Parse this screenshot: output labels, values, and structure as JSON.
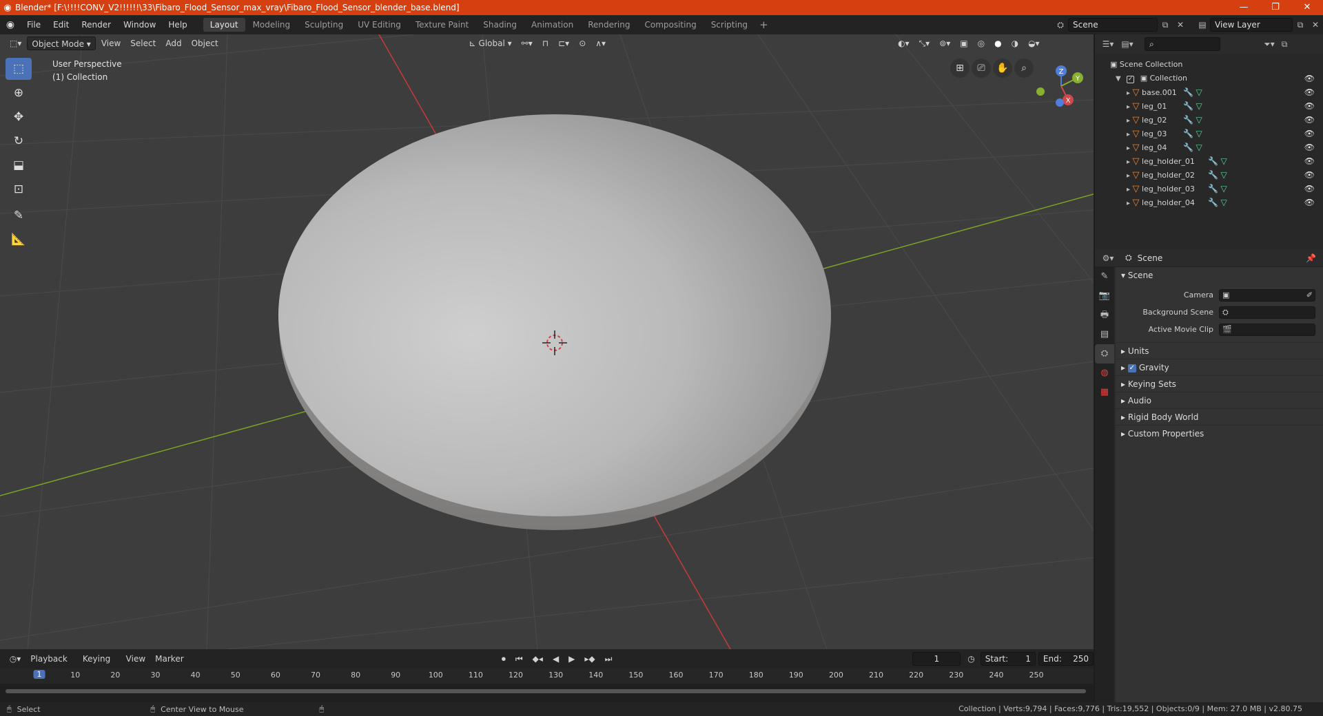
{
  "window": {
    "title": "Blender* [F:\\!!!!CONV_V2!!!!!!\\33\\Fibaro_Flood_Sensor_max_vray\\Fibaro_Flood_Sensor_blender_base.blend]",
    "minimize": "—",
    "restore": "❐",
    "close": "✕"
  },
  "menu": [
    "File",
    "Edit",
    "Render",
    "Window",
    "Help"
  ],
  "workspaces": [
    "Layout",
    "Modeling",
    "Sculpting",
    "UV Editing",
    "Texture Paint",
    "Shading",
    "Animation",
    "Rendering",
    "Compositing",
    "Scripting"
  ],
  "topright": {
    "scene": "Scene",
    "view_layer": "View Layer"
  },
  "viewport": {
    "mode": "Object Mode",
    "menus": [
      "View",
      "Select",
      "Add",
      "Object"
    ],
    "orientation": "Global",
    "perspective": "User Perspective",
    "collection": "(1) Collection",
    "gizmo_axes": {
      "z": "Z",
      "y": "Y",
      "x": "X"
    }
  },
  "outliner": {
    "root": "Scene Collection",
    "collection": "Collection",
    "objects": [
      "base.001",
      "leg_01",
      "leg_02",
      "leg_03",
      "leg_04",
      "leg_holder_01",
      "leg_holder_02",
      "leg_holder_03",
      "leg_holder_04"
    ]
  },
  "properties": {
    "context": "Scene",
    "panel": "Scene",
    "fields": [
      {
        "label": "Camera",
        "value": ""
      },
      {
        "label": "Background Scene",
        "value": ""
      },
      {
        "label": "Active Movie Clip",
        "value": ""
      }
    ],
    "subpanels": [
      "Units",
      "Gravity",
      "Keying Sets",
      "Audio",
      "Rigid Body World",
      "Custom Properties"
    ]
  },
  "timeline": {
    "menus": [
      "Playback",
      "Keying",
      "View",
      "Marker"
    ],
    "current_frame": "1",
    "start_label": "Start:",
    "start": "1",
    "end_label": "End:",
    "end": "250",
    "ticks": [
      "1",
      "10",
      "20",
      "30",
      "40",
      "50",
      "60",
      "70",
      "80",
      "90",
      "100",
      "110",
      "120",
      "130",
      "140",
      "150",
      "160",
      "170",
      "180",
      "190",
      "200",
      "210",
      "220",
      "230",
      "240",
      "250"
    ]
  },
  "status": {
    "select": "Select",
    "center": "Center View to Mouse",
    "stats": "Collection | Verts:9,794 | Faces:9,776 | Tris:19,552 | Objects:0/9 | Mem: 27.0 MB | v2.80.75"
  },
  "colors": {
    "accent": "#4b72b8",
    "titlebar": "#d64010",
    "mesh_icon": "#e8853a",
    "x_axis": "#c83a3a",
    "y_axis": "#7aa426"
  }
}
